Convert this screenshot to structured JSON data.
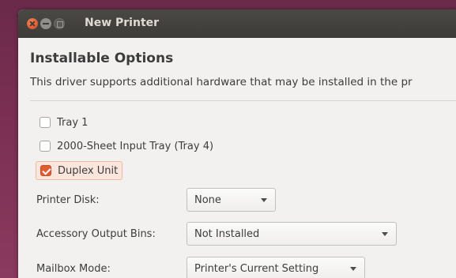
{
  "window": {
    "title": "New Printer"
  },
  "heading": "Installable Options",
  "description": "This driver supports additional hardware that may be installed in the pr",
  "options": [
    {
      "label": "Tray 1",
      "checked": false
    },
    {
      "label": "2000-Sheet Input Tray (Tray 4)",
      "checked": false
    },
    {
      "label": "Duplex Unit",
      "checked": true
    }
  ],
  "fields": [
    {
      "label": "Printer Disk:",
      "value": "None"
    },
    {
      "label": "Accessory Output Bins:",
      "value": "Not Installed"
    },
    {
      "label": "Mailbox Mode:",
      "value": "Printer's Current Setting"
    }
  ],
  "colors": {
    "accent": "#e35d33",
    "titlebar": "#3c3b37",
    "background": "#f2f1f0"
  }
}
